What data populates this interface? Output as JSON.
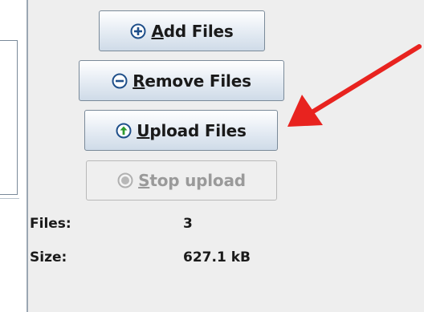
{
  "buttons": {
    "add": {
      "mnemonic": "A",
      "rest": "dd Files",
      "icon": "plus-circle-icon"
    },
    "remove": {
      "mnemonic": "R",
      "rest": "emove Files",
      "icon": "minus-circle-icon"
    },
    "upload": {
      "mnemonic": "U",
      "rest": "pload Files",
      "icon": "up-arrow-circle-icon"
    },
    "stop": {
      "mnemonic": "S",
      "rest": "top upload",
      "icon": "stop-circle-icon",
      "enabled": false
    }
  },
  "info": {
    "files_label": "Files:",
    "files_value": "3",
    "size_label": "Size:",
    "size_value": "627.1 kB"
  },
  "colors": {
    "arrow": "#e8231f",
    "upload_icon_arrow": "#2e9b2e",
    "icon_blue": "#1f4f8a",
    "panel_background": "#eeeeee"
  }
}
